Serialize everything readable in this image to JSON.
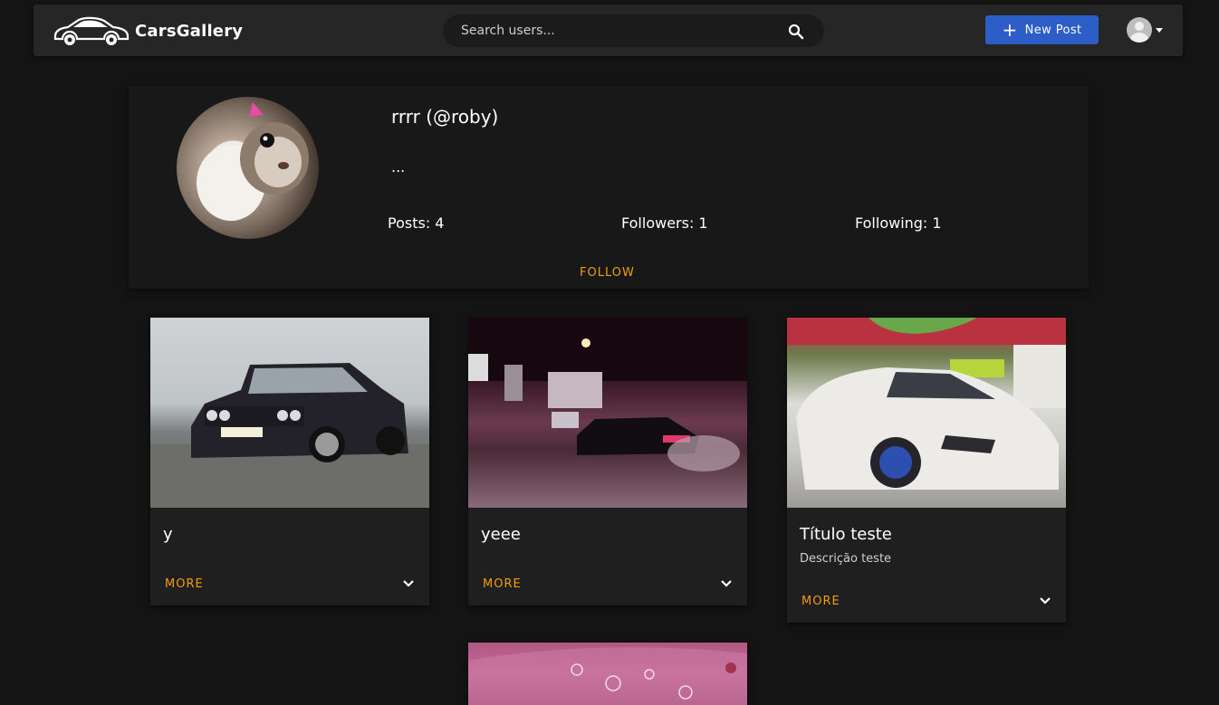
{
  "app": {
    "brand": "CarsGallery",
    "icons": {
      "logo": "car-logo-icon",
      "search": "search-icon",
      "add": "plus-icon",
      "user": "user-avatar-icon",
      "menu": "caret-down-icon",
      "expand": "chevron-down-icon"
    }
  },
  "header": {
    "search_placeholder": "Search users...",
    "new_post_label": "New Post"
  },
  "profile": {
    "name": "rrrr (@roby)",
    "bio": "...",
    "posts": "Posts: 4",
    "followers": "Followers: 1",
    "following": "Following: 1",
    "follow_label": "FOLLOW"
  },
  "posts": [
    {
      "title": "y",
      "description": "",
      "more_label": "MORE"
    },
    {
      "title": "yeee",
      "description": "",
      "more_label": "MORE"
    },
    {
      "title": "Título teste",
      "description": "Descrição teste",
      "more_label": "MORE"
    },
    {
      "title": "",
      "description": "",
      "more_label": ""
    }
  ],
  "colors": {
    "accent": "#f39c12",
    "primary_button": "#2d5ec7",
    "background": "#141414",
    "card": "#1f1f1f"
  }
}
